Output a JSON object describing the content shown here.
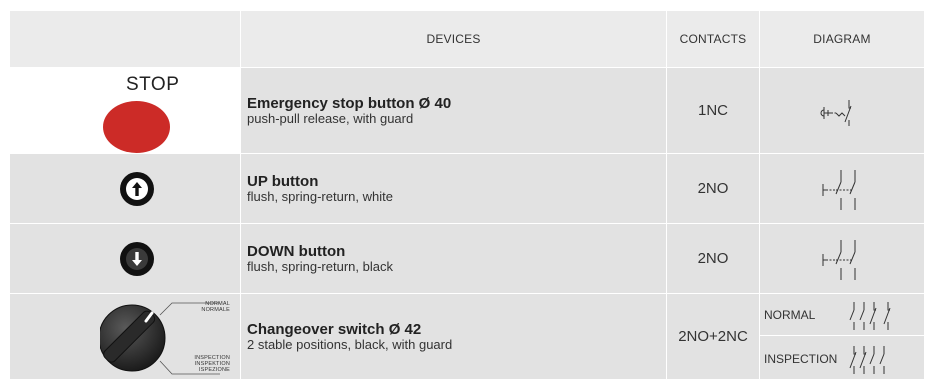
{
  "header": {
    "devices": "DEVICES",
    "contacts": "CONTACTS",
    "diagram": "DIAGRAM"
  },
  "rows": [
    {
      "icon_label": "STOP",
      "icon": "red-mushroom-stop-button",
      "name": "Emergency stop button Ø 40",
      "description": "push-pull release, with guard",
      "contacts": "1NC"
    },
    {
      "icon": "up-arrow-button",
      "name": "UP button",
      "description": "flush, spring-return, white",
      "contacts": "2NO"
    },
    {
      "icon": "down-arrow-button",
      "name": "DOWN button",
      "description": "flush, spring-return, black",
      "contacts": "2NO"
    },
    {
      "icon": "selector-switch",
      "name": "Changeover switch Ø 42",
      "description": "2 stable positions, black, with guard",
      "contacts": "2NO+2NC",
      "positions": {
        "top": [
          "NORMAL",
          "NORMALE"
        ],
        "bottom": [
          "INSPECTION",
          "INSPEKTION",
          "ISPEZIONE"
        ]
      },
      "diagram_labels": [
        "NORMAL",
        "INSPECTION"
      ]
    }
  ],
  "colors": {
    "row_bg": "#e2e2e2",
    "header_bg": "#ebebeb",
    "stop_red": "#cc2b27"
  }
}
